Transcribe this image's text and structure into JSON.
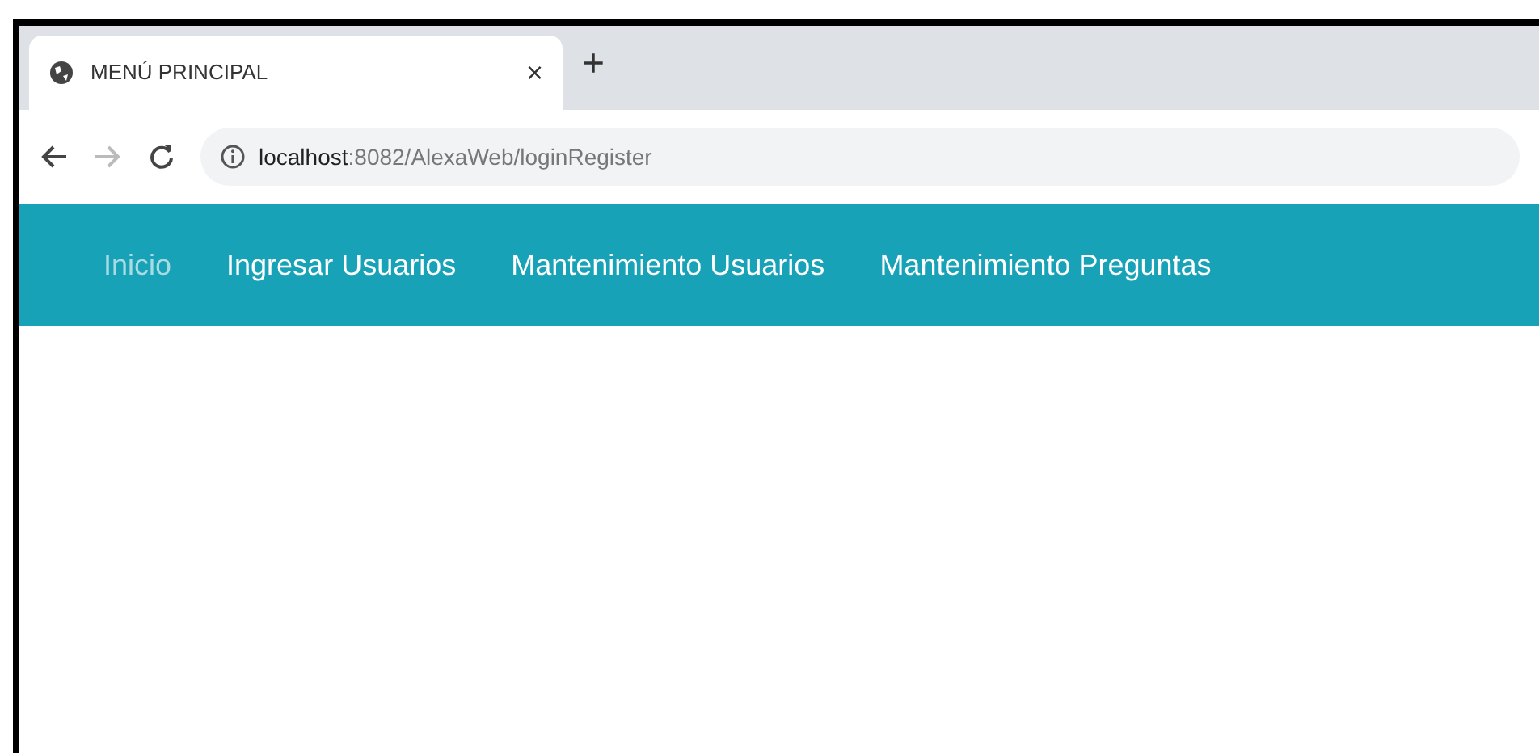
{
  "browser": {
    "tab_title": "MENÚ PRINCIPAL",
    "close": "×",
    "new_tab": "+",
    "url_host": "localhost",
    "url_path": ":8082/AlexaWeb/loginRegister"
  },
  "nav": {
    "items": [
      {
        "label": "Inicio",
        "selected": true
      },
      {
        "label": "Ingresar Usuarios",
        "selected": false
      },
      {
        "label": "Mantenimiento Usuarios",
        "selected": false
      },
      {
        "label": "Mantenimiento Preguntas",
        "selected": false
      }
    ]
  }
}
